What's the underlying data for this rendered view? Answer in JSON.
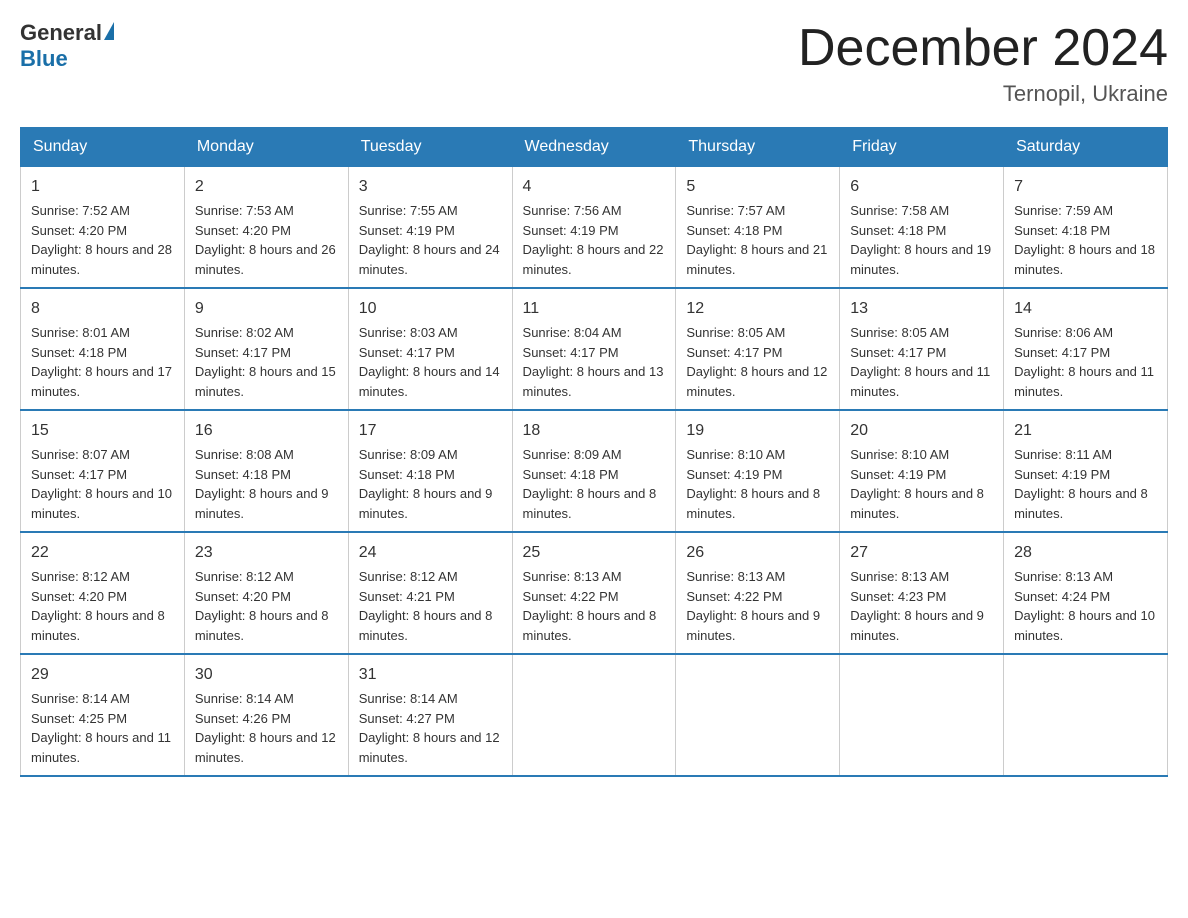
{
  "header": {
    "logo_general": "General",
    "logo_blue": "Blue",
    "title": "December 2024",
    "subtitle": "Ternopil, Ukraine"
  },
  "columns": [
    "Sunday",
    "Monday",
    "Tuesday",
    "Wednesday",
    "Thursday",
    "Friday",
    "Saturday"
  ],
  "weeks": [
    [
      {
        "day": "1",
        "sunrise": "7:52 AM",
        "sunset": "4:20 PM",
        "daylight": "8 hours and 28 minutes."
      },
      {
        "day": "2",
        "sunrise": "7:53 AM",
        "sunset": "4:20 PM",
        "daylight": "8 hours and 26 minutes."
      },
      {
        "day": "3",
        "sunrise": "7:55 AM",
        "sunset": "4:19 PM",
        "daylight": "8 hours and 24 minutes."
      },
      {
        "day": "4",
        "sunrise": "7:56 AM",
        "sunset": "4:19 PM",
        "daylight": "8 hours and 22 minutes."
      },
      {
        "day": "5",
        "sunrise": "7:57 AM",
        "sunset": "4:18 PM",
        "daylight": "8 hours and 21 minutes."
      },
      {
        "day": "6",
        "sunrise": "7:58 AM",
        "sunset": "4:18 PM",
        "daylight": "8 hours and 19 minutes."
      },
      {
        "day": "7",
        "sunrise": "7:59 AM",
        "sunset": "4:18 PM",
        "daylight": "8 hours and 18 minutes."
      }
    ],
    [
      {
        "day": "8",
        "sunrise": "8:01 AM",
        "sunset": "4:18 PM",
        "daylight": "8 hours and 17 minutes."
      },
      {
        "day": "9",
        "sunrise": "8:02 AM",
        "sunset": "4:17 PM",
        "daylight": "8 hours and 15 minutes."
      },
      {
        "day": "10",
        "sunrise": "8:03 AM",
        "sunset": "4:17 PM",
        "daylight": "8 hours and 14 minutes."
      },
      {
        "day": "11",
        "sunrise": "8:04 AM",
        "sunset": "4:17 PM",
        "daylight": "8 hours and 13 minutes."
      },
      {
        "day": "12",
        "sunrise": "8:05 AM",
        "sunset": "4:17 PM",
        "daylight": "8 hours and 12 minutes."
      },
      {
        "day": "13",
        "sunrise": "8:05 AM",
        "sunset": "4:17 PM",
        "daylight": "8 hours and 11 minutes."
      },
      {
        "day": "14",
        "sunrise": "8:06 AM",
        "sunset": "4:17 PM",
        "daylight": "8 hours and 11 minutes."
      }
    ],
    [
      {
        "day": "15",
        "sunrise": "8:07 AM",
        "sunset": "4:17 PM",
        "daylight": "8 hours and 10 minutes."
      },
      {
        "day": "16",
        "sunrise": "8:08 AM",
        "sunset": "4:18 PM",
        "daylight": "8 hours and 9 minutes."
      },
      {
        "day": "17",
        "sunrise": "8:09 AM",
        "sunset": "4:18 PM",
        "daylight": "8 hours and 9 minutes."
      },
      {
        "day": "18",
        "sunrise": "8:09 AM",
        "sunset": "4:18 PM",
        "daylight": "8 hours and 8 minutes."
      },
      {
        "day": "19",
        "sunrise": "8:10 AM",
        "sunset": "4:19 PM",
        "daylight": "8 hours and 8 minutes."
      },
      {
        "day": "20",
        "sunrise": "8:10 AM",
        "sunset": "4:19 PM",
        "daylight": "8 hours and 8 minutes."
      },
      {
        "day": "21",
        "sunrise": "8:11 AM",
        "sunset": "4:19 PM",
        "daylight": "8 hours and 8 minutes."
      }
    ],
    [
      {
        "day": "22",
        "sunrise": "8:12 AM",
        "sunset": "4:20 PM",
        "daylight": "8 hours and 8 minutes."
      },
      {
        "day": "23",
        "sunrise": "8:12 AM",
        "sunset": "4:20 PM",
        "daylight": "8 hours and 8 minutes."
      },
      {
        "day": "24",
        "sunrise": "8:12 AM",
        "sunset": "4:21 PM",
        "daylight": "8 hours and 8 minutes."
      },
      {
        "day": "25",
        "sunrise": "8:13 AM",
        "sunset": "4:22 PM",
        "daylight": "8 hours and 8 minutes."
      },
      {
        "day": "26",
        "sunrise": "8:13 AM",
        "sunset": "4:22 PM",
        "daylight": "8 hours and 9 minutes."
      },
      {
        "day": "27",
        "sunrise": "8:13 AM",
        "sunset": "4:23 PM",
        "daylight": "8 hours and 9 minutes."
      },
      {
        "day": "28",
        "sunrise": "8:13 AM",
        "sunset": "4:24 PM",
        "daylight": "8 hours and 10 minutes."
      }
    ],
    [
      {
        "day": "29",
        "sunrise": "8:14 AM",
        "sunset": "4:25 PM",
        "daylight": "8 hours and 11 minutes."
      },
      {
        "day": "30",
        "sunrise": "8:14 AM",
        "sunset": "4:26 PM",
        "daylight": "8 hours and 12 minutes."
      },
      {
        "day": "31",
        "sunrise": "8:14 AM",
        "sunset": "4:27 PM",
        "daylight": "8 hours and 12 minutes."
      },
      null,
      null,
      null,
      null
    ]
  ]
}
